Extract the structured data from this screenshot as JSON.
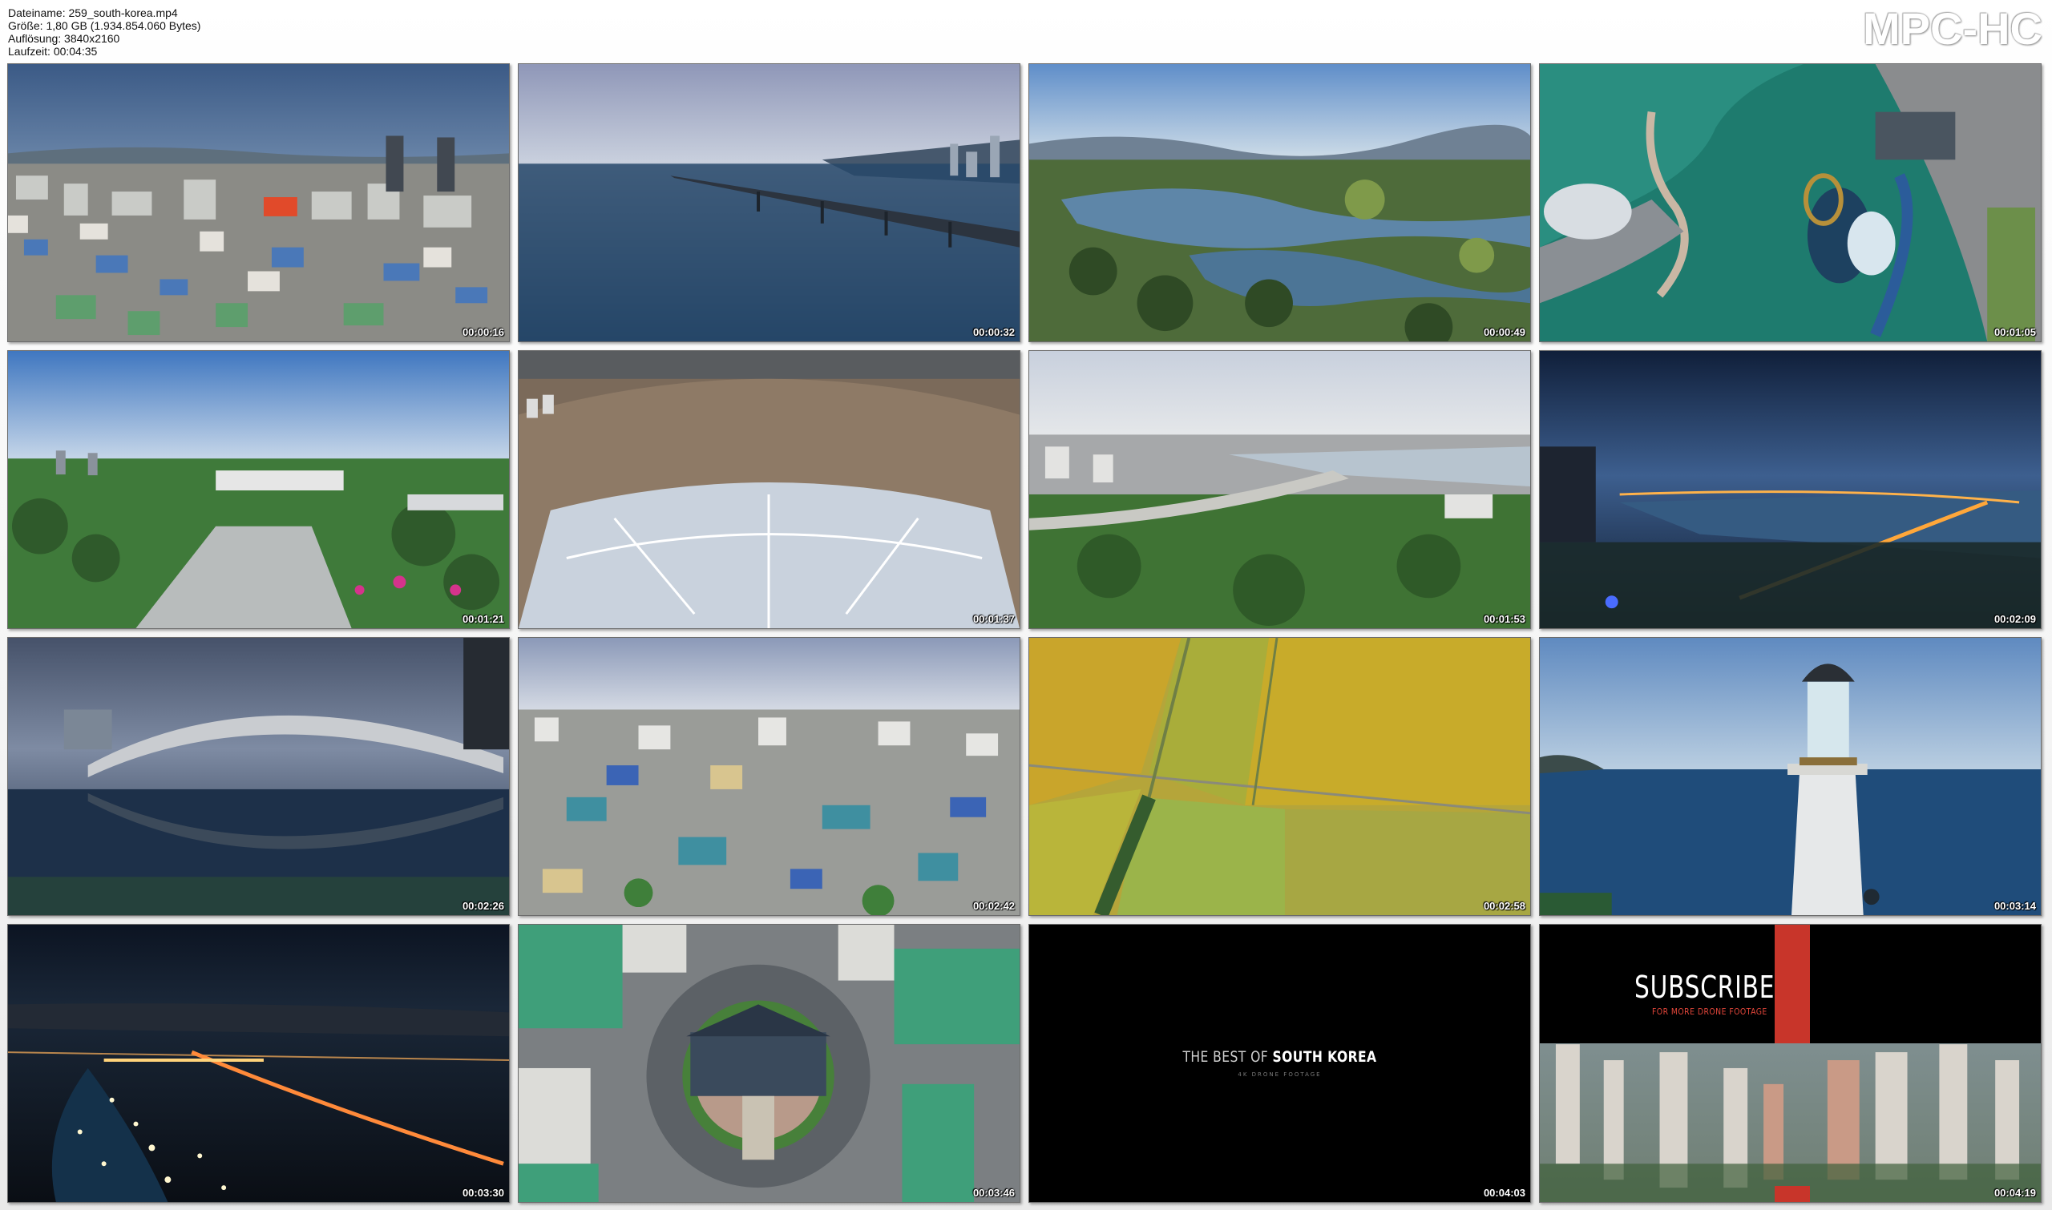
{
  "file_info": {
    "filename": "Dateiname: 259_south-korea.mp4",
    "size": "Größe: 1,80 GB (1.934.854.060 Bytes)",
    "resolution": "Auflösung: 3840x2160",
    "duration": "Laufzeit: 00:04:35"
  },
  "brand": "MPC-HC",
  "thumbnails": [
    {
      "time": "00:00:16"
    },
    {
      "time": "00:00:32"
    },
    {
      "time": "00:00:49"
    },
    {
      "time": "00:01:05"
    },
    {
      "time": "00:01:21"
    },
    {
      "time": "00:01:37"
    },
    {
      "time": "00:01:53"
    },
    {
      "time": "00:02:09"
    },
    {
      "time": "00:02:26"
    },
    {
      "time": "00:02:42"
    },
    {
      "time": "00:02:58"
    },
    {
      "time": "00:03:14"
    },
    {
      "time": "00:03:30"
    },
    {
      "time": "00:03:46"
    },
    {
      "time": "00:04:03"
    },
    {
      "time": "00:04:19"
    }
  ],
  "title_card": {
    "prefix": "THE BEST OF",
    "highlight": "SOUTH KOREA",
    "subline": "4K DRONE FOOTAGE"
  },
  "subscribe_card": {
    "title": "SUBSCRIBE",
    "tagline": "FOR MORE DRONE FOOTAGE"
  },
  "colors": {
    "accent_red": "#c8352a",
    "timestamp": "#ffffff"
  }
}
